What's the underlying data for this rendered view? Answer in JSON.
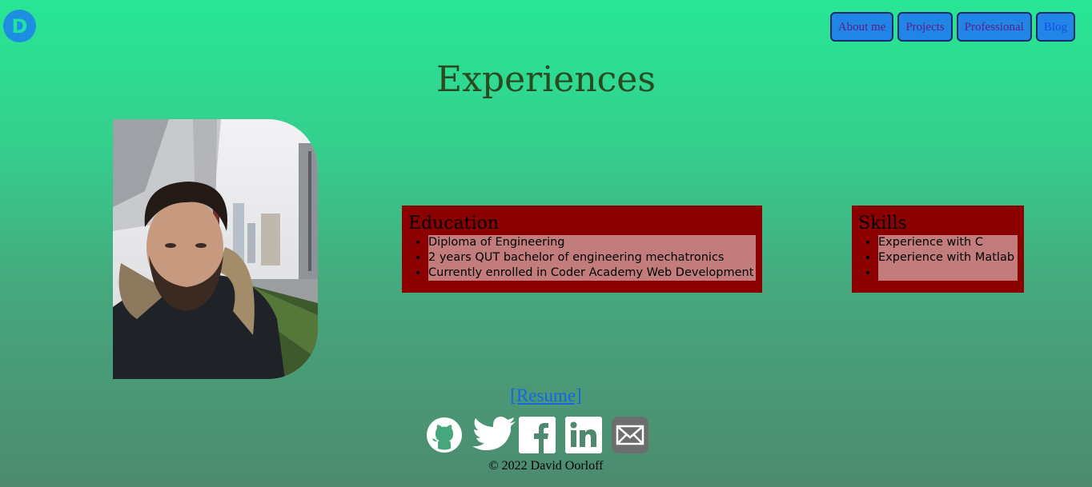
{
  "logo": {
    "letter": "D"
  },
  "nav": [
    {
      "label": "About me"
    },
    {
      "label": "Projects"
    },
    {
      "label": "Professional"
    },
    {
      "label": "Blog"
    }
  ],
  "page_title": "Experiences",
  "education": {
    "heading": "Education",
    "items": [
      "Diploma of Engineering",
      "2 years QUT bachelor of engineering mechatronics",
      "Currently enrolled in Coder Academy Web Development"
    ]
  },
  "skills": {
    "heading": "Skills",
    "items": [
      "Experience with C",
      "Experience with Matlab",
      ""
    ]
  },
  "resume_link": "[Resume]",
  "socials": [
    "github-icon",
    "twitter-icon",
    "facebook-icon",
    "linkedin-icon",
    "email-icon"
  ],
  "footer": "© 2022 David Oorloff",
  "colors": {
    "card_bg": "#8b0000",
    "highlight": "#c27c7c",
    "nav_bg": "#2085e6"
  }
}
